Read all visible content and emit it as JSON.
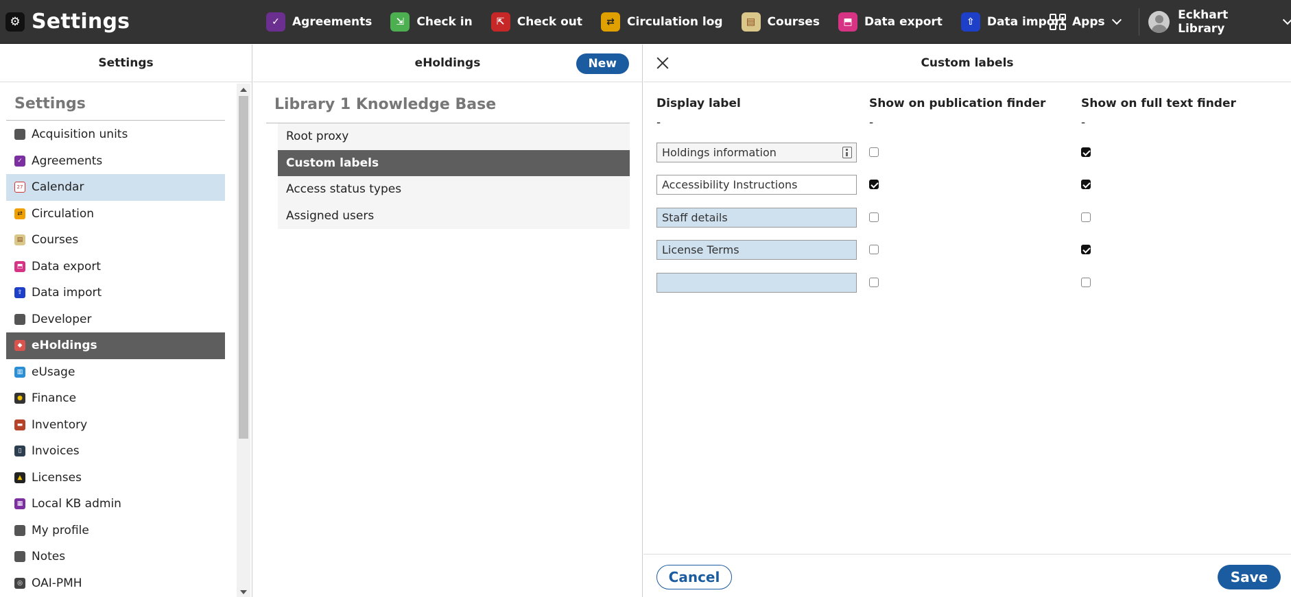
{
  "app": {
    "title": "Settings",
    "icon": "gear-icon"
  },
  "topnav": [
    {
      "label": "Agreements",
      "icon": "agreements-icon",
      "color": "#6b2f8f"
    },
    {
      "label": "Check in",
      "icon": "check-in-icon",
      "color": "#4caf50"
    },
    {
      "label": "Check out",
      "icon": "check-out-icon",
      "color": "#c62828"
    },
    {
      "label": "Circulation log",
      "icon": "circulation-log-icon",
      "color": "#f0a000"
    },
    {
      "label": "Courses",
      "icon": "courses-icon",
      "color": "#d9c88a"
    },
    {
      "label": "Data export",
      "icon": "data-export-icon",
      "color": "#d63384"
    },
    {
      "label": "Data import",
      "icon": "data-import-icon",
      "color": "#1e40c8"
    }
  ],
  "apps_label": "Apps",
  "user": {
    "name": "Eckhart Library"
  },
  "settings_pane": {
    "header": "Settings",
    "heading": "Settings",
    "items": [
      {
        "label": "Acquisition units",
        "color": "#555555"
      },
      {
        "label": "Agreements",
        "color": "#7b2fa0"
      },
      {
        "label": "Calendar",
        "color": "#e6e6e6"
      },
      {
        "label": "Circulation",
        "color": "#f0a000"
      },
      {
        "label": "Courses",
        "color": "#d9c88a"
      },
      {
        "label": "Data export",
        "color": "#d63384"
      },
      {
        "label": "Data import",
        "color": "#1e40c8"
      },
      {
        "label": "Developer",
        "color": "#555555"
      },
      {
        "label": "eHoldings",
        "color": "#d9534f"
      },
      {
        "label": "eUsage",
        "color": "#2a8fd6"
      },
      {
        "label": "Finance",
        "color": "#333333"
      },
      {
        "label": "Inventory",
        "color": "#b5442a"
      },
      {
        "label": "Invoices",
        "color": "#2c3e50"
      },
      {
        "label": "Licenses",
        "color": "#222222"
      },
      {
        "label": "Local KB admin",
        "color": "#7b2fa0"
      },
      {
        "label": "My profile",
        "color": "#555555"
      },
      {
        "label": "Notes",
        "color": "#555555"
      },
      {
        "label": "OAI-PMH",
        "color": "#444444"
      }
    ]
  },
  "eholdings_pane": {
    "header": "eHoldings",
    "new_label": "New",
    "kb_title": "Library 1 Knowledge Base",
    "items": [
      "Root proxy",
      "Custom labels",
      "Access status types",
      "Assigned users"
    ]
  },
  "custom_labels_pane": {
    "header": "Custom labels",
    "columns": [
      "Display label",
      "Show on publication finder",
      "Show on full text finder"
    ],
    "dash": "-",
    "rows": [
      {
        "label": "Holdings information",
        "publication_finder": false,
        "full_text_finder": true
      },
      {
        "label": "Accessibility Instructions",
        "publication_finder": true,
        "full_text_finder": true
      },
      {
        "label": "Staff details",
        "publication_finder": false,
        "full_text_finder": false
      },
      {
        "label": "License Terms",
        "publication_finder": false,
        "full_text_finder": true
      },
      {
        "label": "",
        "publication_finder": false,
        "full_text_finder": false
      }
    ],
    "cancel_label": "Cancel",
    "save_label": "Save"
  }
}
